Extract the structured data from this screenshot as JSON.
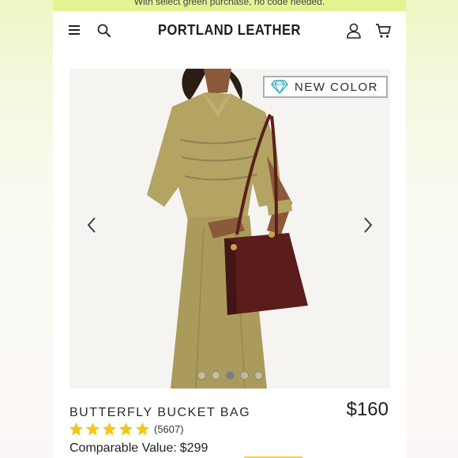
{
  "promo": {
    "text": "With select green purchase, no code needed."
  },
  "header": {
    "logo": "PORTLAND LEATHER",
    "menu_icon": "hamburger-menu-icon",
    "search_icon": "search-icon",
    "account_icon": "user-icon",
    "cart_icon": "cart-icon"
  },
  "gallery": {
    "badge_label": "NEW COLOR",
    "badge_icon": "diamond-icon",
    "image_count": 5,
    "active_index": 2
  },
  "product": {
    "title": "BUTTERFLY BUCKET BAG",
    "price": "$160",
    "rating": 5,
    "review_count": "(5607)",
    "comparable_label": "Comparable Value:",
    "comparable_value": "$299"
  },
  "colors": {
    "promo_bg": "#e4f292",
    "star": "#f5c518",
    "badge_icon": "#3bb0c9",
    "cta": "#efd23a"
  }
}
